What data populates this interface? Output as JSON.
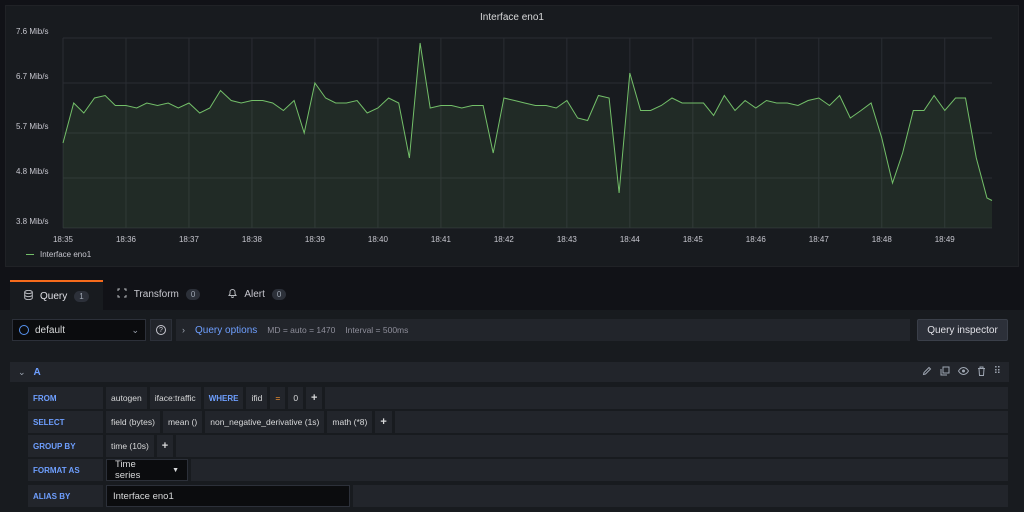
{
  "panel": {
    "title": "Interface eno1",
    "legend": "Interface eno1"
  },
  "chart_data": {
    "type": "area",
    "title": "Interface eno1",
    "color": "#73bf69",
    "y_tick_labels": [
      "3.8 Mib/s",
      "4.8 Mib/s",
      "5.7 Mib/s",
      "6.7 Mib/s",
      "7.6 Mib/s"
    ],
    "y_ticks": [
      3.8,
      4.8,
      5.7,
      6.7,
      7.6
    ],
    "ylim": [
      3.8,
      7.6
    ],
    "x_tick_labels": [
      "18:35",
      "18:36",
      "18:37",
      "18:38",
      "18:39",
      "18:40",
      "18:41",
      "18:42",
      "18:43",
      "18:44",
      "18:45",
      "18:46",
      "18:47",
      "18:48",
      "18:49"
    ],
    "x_range_minutes": [
      0,
      14.75
    ],
    "grid": true,
    "legend_position": "bottom-left",
    "series": [
      {
        "name": "Interface eno1",
        "x": [
          0,
          0.17,
          0.33,
          0.5,
          0.67,
          0.83,
          1,
          1.17,
          1.33,
          1.5,
          1.67,
          1.83,
          2,
          2.17,
          2.33,
          2.5,
          2.67,
          2.83,
          3,
          3.17,
          3.33,
          3.5,
          3.67,
          3.83,
          4,
          4.17,
          4.33,
          4.5,
          4.67,
          4.83,
          5,
          5.17,
          5.33,
          5.5,
          5.67,
          5.83,
          6,
          6.17,
          6.33,
          6.5,
          6.67,
          6.83,
          7,
          7.17,
          7.33,
          7.5,
          7.67,
          7.83,
          8,
          8.17,
          8.33,
          8.5,
          8.67,
          8.83,
          9,
          9.17,
          9.33,
          9.5,
          9.67,
          9.83,
          10,
          10.17,
          10.33,
          10.5,
          10.67,
          10.83,
          11,
          11.17,
          11.33,
          11.5,
          11.67,
          11.83,
          12,
          12.17,
          12.33,
          12.5,
          12.67,
          12.83,
          13,
          13.17,
          13.33,
          13.5,
          13.67,
          13.83,
          14,
          14.17,
          14.33,
          14.5,
          14.67,
          14.75
        ],
        "values": [
          5.5,
          6.3,
          6.1,
          6.4,
          6.45,
          6.25,
          6.25,
          6.2,
          6.3,
          6.25,
          6.3,
          6.2,
          6.3,
          6.1,
          6.2,
          6.55,
          6.35,
          6.3,
          6.35,
          6.35,
          6.3,
          6.15,
          6.35,
          5.7,
          6.7,
          6.4,
          6.3,
          6.3,
          6.35,
          6.1,
          6.2,
          6.4,
          6.3,
          5.2,
          7.5,
          6.2,
          6.25,
          6.25,
          6.2,
          6.25,
          6.25,
          5.3,
          6.4,
          6.35,
          6.3,
          6.25,
          6.25,
          6.2,
          6.35,
          6.0,
          5.95,
          6.45,
          6.4,
          4.5,
          6.9,
          6.15,
          6.15,
          6.25,
          6.4,
          6.3,
          6.3,
          6.3,
          6.05,
          6.45,
          6.15,
          6.35,
          6.2,
          6.35,
          6.3,
          6.3,
          6.25,
          6.35,
          6.4,
          6.25,
          6.45,
          6.0,
          6.15,
          6.3,
          5.6,
          4.7,
          5.3,
          6.15,
          6.15,
          6.45,
          6.15,
          6.4,
          6.4,
          5.2,
          4.4,
          4.35
        ]
      }
    ]
  },
  "tabs": [
    {
      "label": "Query",
      "count": "1",
      "icon": "database-icon"
    },
    {
      "label": "Transform",
      "count": "0",
      "icon": "transform-icon"
    },
    {
      "label": "Alert",
      "count": "0",
      "icon": "bell-icon"
    }
  ],
  "toolbar": {
    "datasource": "default",
    "query_options_label": "Query options",
    "md_text": "MD = auto = 1470",
    "interval_text": "Interval = 500ms",
    "inspector_label": "Query inspector"
  },
  "query": {
    "ref_id": "A",
    "from": {
      "keyword": "FROM",
      "policy": "autogen",
      "measurement": "iface:traffic",
      "where_keyword": "WHERE",
      "tag": "ifid",
      "operator": "=",
      "value": "0",
      "add": "+"
    },
    "select": {
      "keyword": "SELECT",
      "parts": [
        "field (bytes)",
        "mean ()",
        "non_negative_derivative (1s)",
        "math (*8)"
      ],
      "add": "+"
    },
    "group_by": {
      "keyword": "GROUP BY",
      "parts": [
        "time (10s)"
      ],
      "add": "+"
    },
    "format_as": {
      "keyword": "FORMAT AS",
      "value": "Time series"
    },
    "alias_by": {
      "keyword": "ALIAS BY",
      "value": "Interface eno1"
    }
  }
}
